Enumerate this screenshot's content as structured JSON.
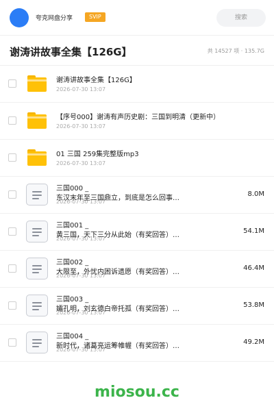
{
  "header": {
    "brand": "夸克网盘分享",
    "vip_badge": "SVIP",
    "search_label": "搜索"
  },
  "folder": {
    "title": "谢涛讲故事全集【126G】",
    "stats": "共 14527 项 · 135.7G"
  },
  "items": [
    {
      "type": "folder",
      "name": "谢涛讲故事全集【126G】",
      "date": "2026-07-30 13:07",
      "size": ""
    },
    {
      "type": "folder",
      "name": "【序号000】谢涛有声历史剧：三国到明清（更新中）",
      "date": "2026-07-30 13:07",
      "size": ""
    },
    {
      "type": "folder",
      "name": "01 三国  259集完整版mp3",
      "date": "2026-07-30 13:07",
      "size": ""
    },
    {
      "type": "file",
      "name": "三国000 _\n东汉末年至三国鼎立，到底是怎么回事…",
      "date": "2026-07-30 13:07",
      "size": "8.0M"
    },
    {
      "type": "file",
      "name": "三国001 _\n黄三国，天下三分从此始（有奖回答）…",
      "date": "2026-07-30 13:07",
      "size": "54.1M"
    },
    {
      "type": "file",
      "name": "三国002 _\n大限至，外忧内困诉遗愿（有奖回答）…",
      "date": "2026-07-30 13:07",
      "size": "46.4M"
    },
    {
      "type": "file",
      "name": "三国003 _\n孀孔明，刘玄德白帝托孤（有奖回答）…",
      "date": "2026-07-30 13:07",
      "size": "53.8M"
    },
    {
      "type": "file",
      "name": "三国004 _\n新时代，诸葛亮运筹帷幄（有奖回答）…",
      "date": "2026-07-30 13:07",
      "size": "49.2M"
    }
  ],
  "watermark": "miosou.cc",
  "colors": {
    "accent": "#2b7df6",
    "vip": "#f5a623",
    "folder": "#ffc107",
    "watermark": "#3cb44b"
  }
}
